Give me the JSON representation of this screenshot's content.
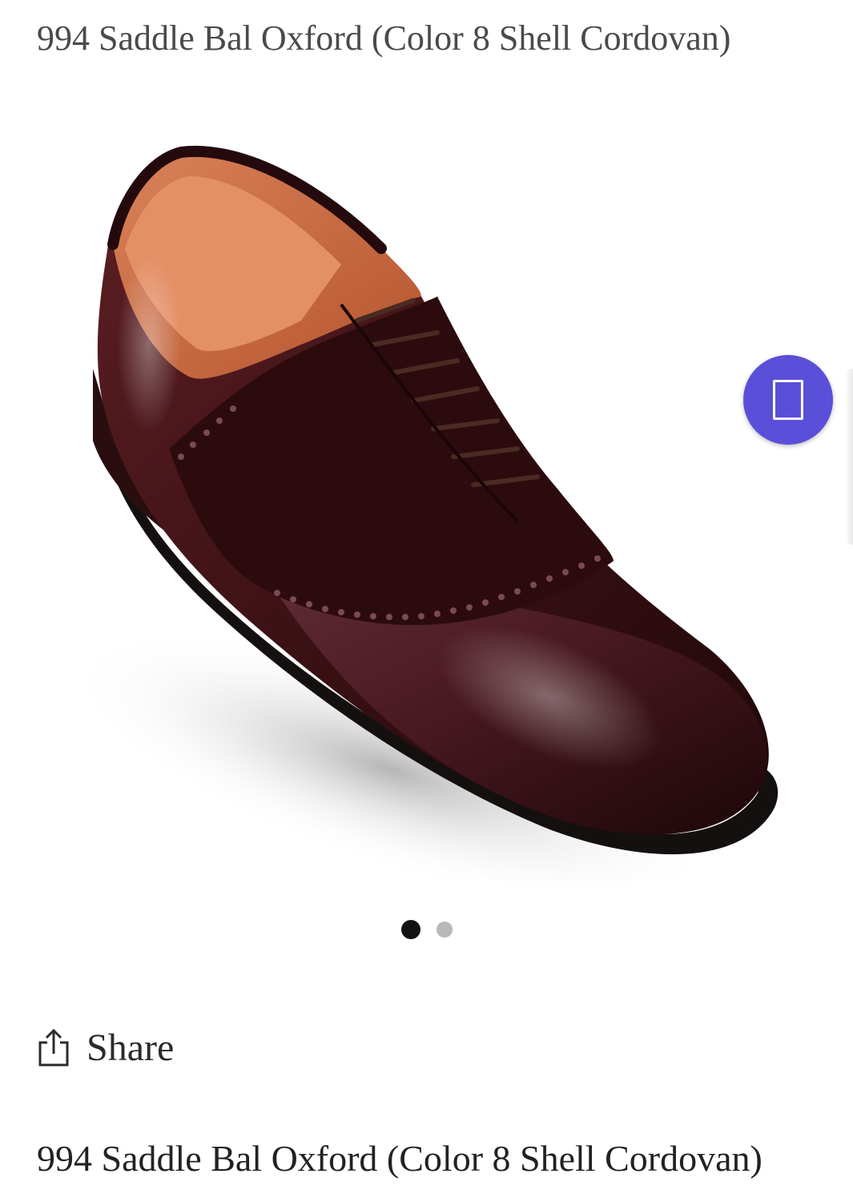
{
  "header": {
    "title": "994 Saddle Bal Oxford (Color 8 Shell Cordovan)"
  },
  "gallery": {
    "image_subject": "saddle-oxford-shoe-photo",
    "active_index": 1,
    "total": 2,
    "fab_color": "#5a4fd8",
    "shoe_color": "#3d1216"
  },
  "share": {
    "label": "Share",
    "icon": "share-icon"
  },
  "product": {
    "title": "994 Saddle Bal Oxford (Color 8 Shell Cordovan)"
  }
}
